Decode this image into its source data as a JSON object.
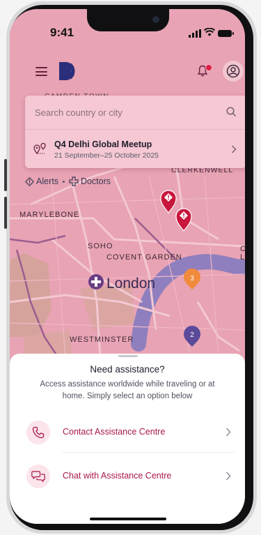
{
  "status_bar": {
    "time": "9:41"
  },
  "search": {
    "placeholder": "Search country or city"
  },
  "event": {
    "title": "Q4 Delhi Global Meetup",
    "dates": "21 September–25 October 2025"
  },
  "filters": [
    {
      "label": "Alerts"
    },
    {
      "label": "Doctors"
    }
  ],
  "map": {
    "city_label": "London",
    "areas": [
      "CAMDEN TOWN",
      "CLERKENWELL",
      "MARYLEBONE",
      "SOHO",
      "COVENT GARDEN",
      "WESTMINSTER"
    ],
    "clusters": [
      {
        "count": "3",
        "color": "#f08a3c"
      },
      {
        "count": "2",
        "color": "#5b4a9a"
      }
    ],
    "alert_marker_color": "#c8163c"
  },
  "assistance": {
    "title": "Need assistance?",
    "description": "Access assistance worldwide while traveling or at home. Simply select an option below",
    "options": [
      {
        "label": "Contact Assistance Centre",
        "icon": "phone-icon"
      },
      {
        "label": "Chat with Assistance Centre",
        "icon": "chat-bubbles-icon"
      }
    ]
  },
  "colors": {
    "brand": "#a8174a",
    "overlay": "#e8a3b4"
  }
}
